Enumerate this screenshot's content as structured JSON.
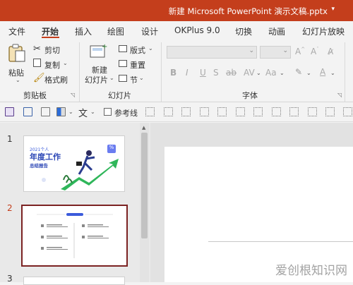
{
  "window": {
    "title": "新建 Microsoft PowerPoint 演示文稿.pptx"
  },
  "tabs": [
    "文件",
    "开始",
    "插入",
    "绘图",
    "设计",
    "OKPlus 9.0",
    "切换",
    "动画",
    "幻灯片放映"
  ],
  "active_tab": "开始",
  "ribbon": {
    "clipboard": {
      "paste": "粘贴",
      "cut": "剪切",
      "copy": "复制",
      "format_painter": "格式刷",
      "group": "剪贴板"
    },
    "slides": {
      "new_slide_line1": "新建",
      "new_slide_line2": "幻灯片",
      "layout": "版式",
      "reset": "重置",
      "section": "节",
      "group": "幻灯片"
    },
    "font": {
      "group": "字体",
      "font_name": "",
      "font_size": ""
    }
  },
  "qat": {
    "guides_label": "参考线"
  },
  "slides": [
    {
      "number": "1",
      "title_line1": "2021个人",
      "title_line2": "年度工作",
      "title_line3": "总结报告",
      "badge": "%"
    },
    {
      "number": "2",
      "selected": true
    },
    {
      "number": "3"
    }
  ],
  "colors": {
    "accent": "#c43e1c",
    "selection": "#7b2222",
    "thumb_blue": "#3b5bdb",
    "thumb_green": "#2fb65a"
  },
  "watermark": "爱创根知识网"
}
